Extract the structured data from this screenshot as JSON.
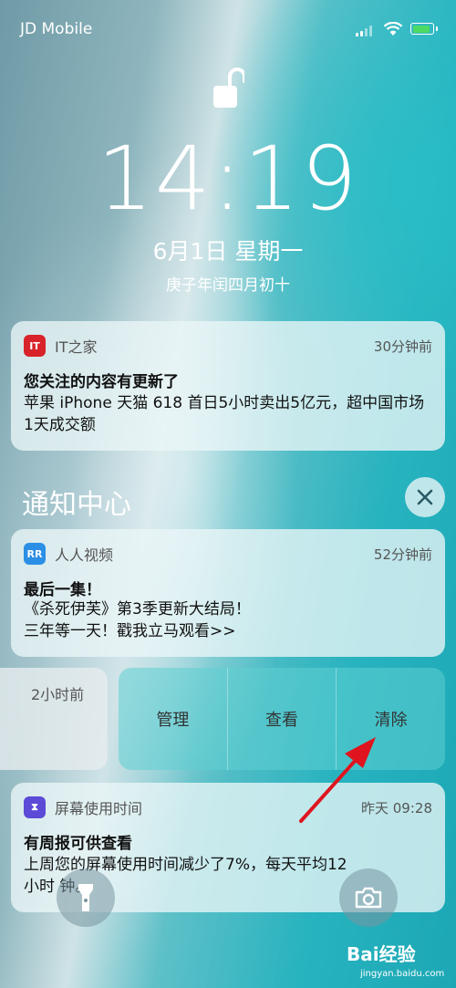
{
  "status_bar": {
    "carrier": "JD Mobile"
  },
  "lock_screen": {
    "time": "14:19",
    "date": "6月1日 星期一",
    "lunar_date": "庚子年闰四月初十"
  },
  "top_notification": {
    "app_icon_text": "IT",
    "app_name": "IT之家",
    "ago": "30分钟前",
    "title": "您关注的内容有更新了",
    "body": "苹果 iPhone 天猫 618 首日5小时卖出5亿元，超中国市场1天成交额",
    "icon_color": "#d8232a"
  },
  "notification_center": {
    "title": "通知中心",
    "close_icon": "close-icon"
  },
  "notifications": [
    {
      "app_icon_text": "RR",
      "app_name": "人人视频",
      "ago": "52分钟前",
      "title": "最后一集！",
      "line1": "《杀死伊芙》第3季更新大结局！",
      "line2": "三年等一天！戳我立马观看>>",
      "icon_color": "#2b8fe6"
    },
    {
      "app_icon_text": "⧗",
      "app_name": "屏幕使用时间",
      "ago": "昨天 09:28",
      "title": "有周报可供查看",
      "line1": "上周您的屏幕使用时间减少了7%，每天平均12",
      "line2": "小时  钟。",
      "icon_color": "#5b4bd6"
    }
  ],
  "swiped_notification": {
    "ago": "2小时前",
    "actions": [
      "管理",
      "查看",
      "清除"
    ]
  },
  "bottom_controls": {
    "flashlight_icon": "flashlight-icon",
    "camera_icon": "camera-icon"
  },
  "watermark": {
    "text": "Bai经验",
    "sub": "jingyan.baidu.com"
  },
  "colors": {
    "accent_teal": "#27b3bf",
    "battery_green": "#4cd964",
    "arrow_red": "#e0141e"
  }
}
